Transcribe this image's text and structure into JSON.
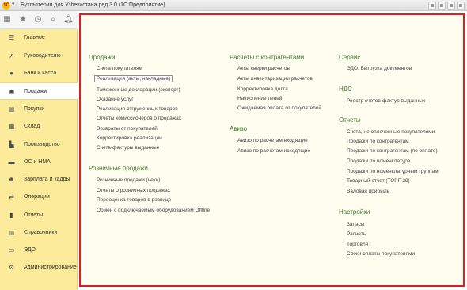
{
  "window": {
    "title": "Бухгалтерия для Узбекистана ред.3.0  (1С:Предприятие)"
  },
  "colors": {
    "sidebar": "#fbeb9a",
    "highlight_border": "#e31c1c",
    "section_title": "#3e7a2c"
  },
  "toolbar": {
    "icons": [
      "apps-icon",
      "star-icon",
      "history-icon",
      "search-icon",
      "bell-icon"
    ]
  },
  "sidebar": {
    "items": [
      {
        "label": "Главное",
        "icon": "menu-lines-icon"
      },
      {
        "label": "Руководителю",
        "icon": "trend-chart-icon"
      },
      {
        "label": "Банк и касса",
        "icon": "coins-icon"
      },
      {
        "label": "Продажи",
        "icon": "shopping-bag-icon",
        "active": true
      },
      {
        "label": "Покупки",
        "icon": "cart-icon"
      },
      {
        "label": "Склад",
        "icon": "warehouse-icon"
      },
      {
        "label": "Производство",
        "icon": "factory-icon"
      },
      {
        "label": "ОС и НМА",
        "icon": "truck-icon"
      },
      {
        "label": "Зарплата и кадры",
        "icon": "people-icon"
      },
      {
        "label": "Операции",
        "icon": "operations-icon"
      },
      {
        "label": "Отчеты",
        "icon": "bar-chart-icon"
      },
      {
        "label": "Справочники",
        "icon": "book-icon"
      },
      {
        "label": "ЭДО",
        "icon": "edo-icon"
      },
      {
        "label": "Администрирование",
        "icon": "gear-icon"
      }
    ]
  },
  "main": {
    "col1": {
      "sales": {
        "title": "Продажи",
        "items": [
          "Счета покупателям",
          "Реализация (акты, накладные)",
          "Таможенные декларации (экспорт)",
          "Оказание услуг",
          "Реализация отгруженных товаров",
          "Отчеты комиссионеров о продажах",
          "Возвраты от покупателей",
          "Корректировка реализации",
          "Счета-фактуры выданные"
        ]
      },
      "retail": {
        "title": "Розничные продажи",
        "items": [
          "Розничные продажи (чеки)",
          "Отчеты о розничных продажах",
          "Переоценка товаров в рознице",
          "Обмен с подключаемым оборудованием Offline"
        ]
      }
    },
    "col2": {
      "settlements": {
        "title": "Расчеты с контрагентами",
        "items": [
          "Акты сверки расчетов",
          "Акты инвентаризации расчетов",
          "Корректировка долга",
          "Начисление пеней",
          "Ожидаемая оплата от покупателей"
        ]
      },
      "aviso": {
        "title": "Авизо",
        "items": [
          "Авизо по расчетам входящие",
          "Авизо по расчетам исходящие"
        ]
      }
    },
    "col3": {
      "service": {
        "title": "Сервис",
        "items": [
          "ЭДО: Выгрузка документов"
        ]
      },
      "vat": {
        "title": "НДС",
        "items": [
          "Реестр счетов-фактур выданных"
        ]
      },
      "reports": {
        "title": "Отчеты",
        "items": [
          "Счета, не оплаченные покупателями",
          "Продажи по контрагентам",
          "Продажи по контрагентам (по оплате)",
          "Продажи по номенклатуре",
          "Продажи по номенклатурным группам",
          "Товарный отчет (ТОРГ-29)",
          "Валовая прибыль"
        ]
      },
      "settings": {
        "title": "Настройки",
        "items": [
          "Запасы",
          "Расчеты",
          "Торговля",
          "Сроки оплаты покупателями"
        ]
      }
    }
  }
}
